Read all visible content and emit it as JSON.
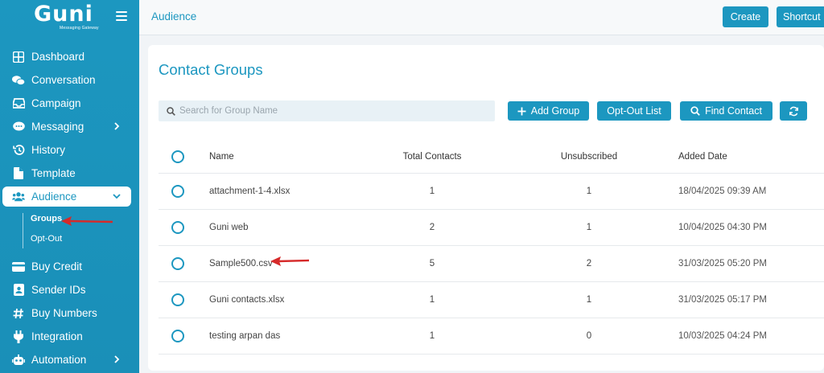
{
  "brand": {
    "name": "Guni",
    "tagline": "Messaging Gateway"
  },
  "sidebar": {
    "items": [
      {
        "label": "Dashboard",
        "icon": "grid-icon"
      },
      {
        "label": "Conversation",
        "icon": "chat-bubbles-icon"
      },
      {
        "label": "Campaign",
        "icon": "inbox-icon"
      },
      {
        "label": "Messaging",
        "icon": "message-icon",
        "has_submenu": true
      },
      {
        "label": "History",
        "icon": "history-icon"
      },
      {
        "label": "Template",
        "icon": "file-icon"
      },
      {
        "label": "Audience",
        "icon": "users-icon",
        "active": true,
        "expanded": true
      },
      {
        "label": "Buy Credit",
        "icon": "credit-card-icon"
      },
      {
        "label": "Sender IDs",
        "icon": "id-badge-icon"
      },
      {
        "label": "Buy Numbers",
        "icon": "hash-icon"
      },
      {
        "label": "Integration",
        "icon": "plug-icon"
      },
      {
        "label": "Automation",
        "icon": "robot-icon",
        "has_submenu": true
      }
    ],
    "audience_sub": [
      {
        "label": "Groups",
        "current": true
      },
      {
        "label": "Opt-Out"
      }
    ]
  },
  "topbar": {
    "title": "Audience",
    "create_label": "Create",
    "shortcut_label": "Shortcut"
  },
  "main": {
    "title": "Contact Groups",
    "search_placeholder": "Search for Group Name",
    "add_group_label": "Add Group",
    "optout_list_label": "Opt-Out List",
    "find_contact_label": "Find Contact",
    "columns": {
      "name": "Name",
      "total": "Total Contacts",
      "unsub": "Unsubscribed",
      "date": "Added Date"
    },
    "rows": [
      {
        "name": "attachment-1-4.xlsx",
        "total": "1",
        "unsub": "1",
        "date": "18/04/2025 09:39 AM"
      },
      {
        "name": "Guni web",
        "total": "2",
        "unsub": "1",
        "date": "10/04/2025 04:30 PM"
      },
      {
        "name": "Sample500.csv",
        "total": "5",
        "unsub": "2",
        "date": "31/03/2025 05:20 PM"
      },
      {
        "name": "Guni contacts.xlsx",
        "total": "1",
        "unsub": "1",
        "date": "31/03/2025 05:17 PM"
      },
      {
        "name": "testing arpan das",
        "total": "1",
        "unsub": "0",
        "date": "10/03/2025 04:24 PM"
      }
    ]
  },
  "colors": {
    "accent": "#1c97c0",
    "annotation_arrow": "#d62a2a"
  }
}
